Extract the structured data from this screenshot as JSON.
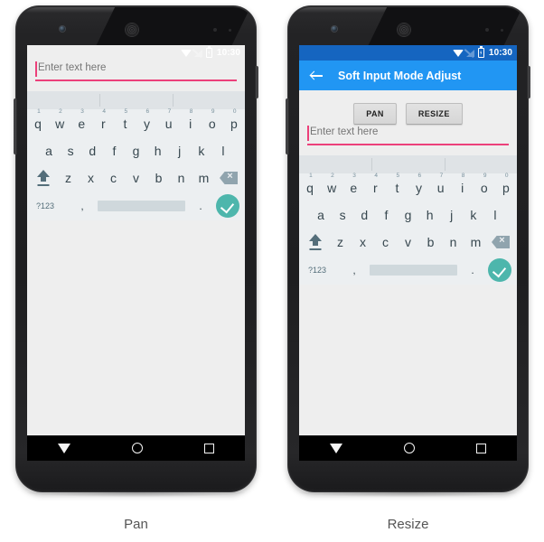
{
  "panels": [
    {
      "caption": "Pan",
      "mode": "pan",
      "show_toolbar": false,
      "show_buttons": false,
      "statusbar": {
        "time": "10:30",
        "icons": [
          "wifi-icon",
          "signal-off-icon",
          "battery-charging-icon"
        ]
      },
      "edittext": {
        "hint": "Enter text here",
        "value": ""
      }
    },
    {
      "caption": "Resize",
      "mode": "resize",
      "show_toolbar": true,
      "show_buttons": true,
      "statusbar": {
        "time": "10:30",
        "icons": [
          "wifi-icon",
          "signal-off-icon",
          "battery-charging-icon"
        ]
      },
      "toolbar": {
        "title": "Soft Input Mode Adjust",
        "nav_icon": "back-arrow-icon"
      },
      "buttons": [
        {
          "label": "PAN"
        },
        {
          "label": "RESIZE"
        }
      ],
      "edittext": {
        "hint": "Enter text here",
        "value": ""
      }
    }
  ],
  "keyboard": {
    "suggestion_bar": {
      "dividers": 2,
      "suggestions": [
        "",
        "",
        ""
      ]
    },
    "row1": [
      {
        "key": "q",
        "num": "1"
      },
      {
        "key": "w",
        "num": "2"
      },
      {
        "key": "e",
        "num": "3"
      },
      {
        "key": "r",
        "num": "4"
      },
      {
        "key": "t",
        "num": "5"
      },
      {
        "key": "y",
        "num": "6"
      },
      {
        "key": "u",
        "num": "7"
      },
      {
        "key": "i",
        "num": "8"
      },
      {
        "key": "o",
        "num": "9"
      },
      {
        "key": "p",
        "num": "0"
      }
    ],
    "row2": [
      "a",
      "s",
      "d",
      "f",
      "g",
      "h",
      "j",
      "k",
      "l"
    ],
    "row3": [
      "z",
      "x",
      "c",
      "v",
      "b",
      "n",
      "m"
    ],
    "shift_icon": "shift-icon",
    "backspace_icon": "backspace-icon",
    "row4": {
      "symbols_label": "?123",
      "comma": ",",
      "period": ".",
      "space_label": "",
      "enter_icon": "check-icon"
    }
  },
  "navbar": {
    "back_icon": "nav-back-triangle-icon",
    "home_icon": "nav-home-circle-icon",
    "recents_icon": "nav-recents-square-icon"
  },
  "colors": {
    "toolbar_blue": "#2196f3",
    "statusbar_blue_dark": "#1565c0",
    "accent_pink": "#ec407a",
    "enter_teal": "#4db6ac",
    "screen_bg": "#eeeeee",
    "keyboard_bg": "#eceff1",
    "suggestion_bg": "#dfe3e6"
  }
}
